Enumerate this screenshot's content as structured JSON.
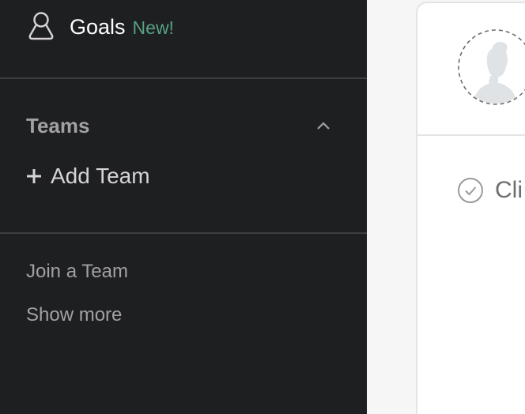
{
  "sidebar": {
    "goals": {
      "label": "Goals",
      "badge": "New!"
    },
    "teams": {
      "title": "Teams",
      "add_label": "Add Team"
    },
    "join_label": "Join a Team",
    "show_more_label": "Show more"
  },
  "main": {
    "task_text": "Cli"
  },
  "colors": {
    "sidebar_bg": "#1e1f21",
    "badge_green": "#58a182",
    "muted_text": "#a2a0a2"
  }
}
